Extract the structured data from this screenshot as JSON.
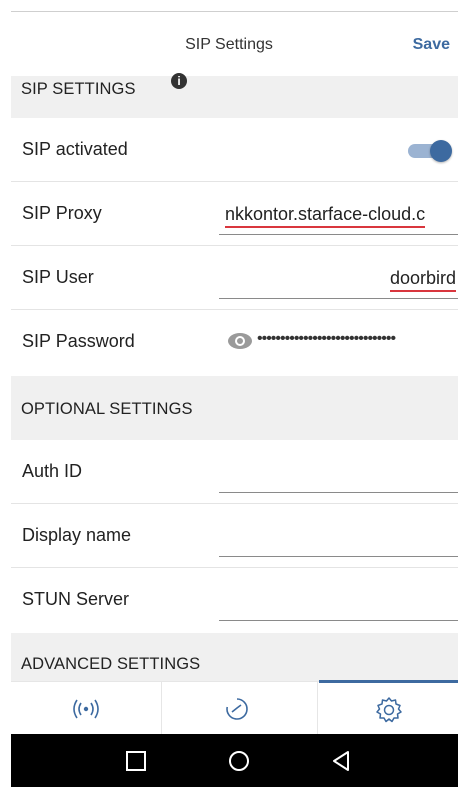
{
  "header": {
    "title": "SIP Settings",
    "save_label": "Save"
  },
  "sections": {
    "sip": "SIP SETTINGS",
    "optional": "OPTIONAL SETTINGS",
    "advanced": "ADVANCED SETTINGS"
  },
  "sip_settings": {
    "activated_label": "SIP activated",
    "activated": true,
    "proxy_label": "SIP Proxy",
    "proxy_value": "nkkontor.starface-cloud.c",
    "user_label": "SIP User",
    "user_value": "doorbird",
    "password_label": "SIP Password",
    "password_mask": "••••••••••••••••••••••••••••••"
  },
  "optional_settings": {
    "auth_id_label": "Auth ID",
    "display_name_label": "Display name",
    "stun_label": "STUN Server"
  },
  "tabs": [
    {
      "icon": "broadcast-icon",
      "active": false
    },
    {
      "icon": "history-clock-icon",
      "active": false
    },
    {
      "icon": "settings-gear-icon",
      "active": true
    }
  ],
  "colors": {
    "accent": "#3d6aa0",
    "section_bg": "#f0f0f0",
    "error_underline": "#d9363e"
  }
}
